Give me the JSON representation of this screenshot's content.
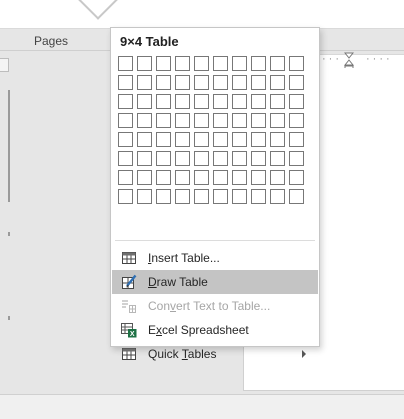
{
  "ribbon": {
    "group_label": "Pages"
  },
  "table_menu": {
    "title": "9×4 Table",
    "grid": {
      "columns": 10,
      "rows": 8
    },
    "items": [
      {
        "pre": "",
        "u": "I",
        "post": "nsert Table...",
        "icon": "insert-table-icon",
        "state": "normal"
      },
      {
        "pre": "",
        "u": "D",
        "post": "raw Table",
        "icon": "draw-table-icon",
        "state": "highlighted"
      },
      {
        "pre": "Con",
        "u": "v",
        "post": "ert Text to Table...",
        "icon": "convert-text-to-table-icon",
        "state": "disabled"
      },
      {
        "pre": "E",
        "u": "x",
        "post": "cel Spreadsheet",
        "icon": "excel-spreadsheet-icon",
        "state": "normal"
      },
      {
        "pre": "Quick ",
        "u": "T",
        "post": "ables",
        "icon": "quick-tables-icon",
        "state": "normal",
        "submenu": true
      }
    ]
  },
  "colors": {
    "highlight": "#c4c4c4",
    "disabled_text": "#a6a6a6",
    "excel_green": "#1e7145",
    "pencil_blue": "#2f6fb3"
  }
}
